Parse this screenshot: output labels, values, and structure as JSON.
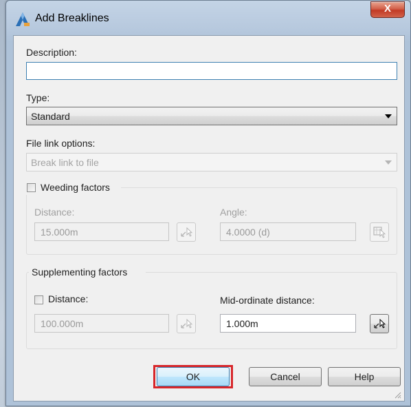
{
  "window": {
    "title": "Add Breaklines",
    "close_label": "X"
  },
  "description": {
    "label": "Description:",
    "value": ""
  },
  "type": {
    "label": "Type:",
    "selected": "Standard"
  },
  "file_link": {
    "label": "File link options:",
    "selected": "Break link to file"
  },
  "weeding": {
    "label": "Weeding factors",
    "checked": false,
    "distance_label": "Distance:",
    "distance_value": "15.000m",
    "angle_label": "Angle:",
    "angle_value": "4.0000 (d)"
  },
  "supplementing": {
    "label": "Supplementing factors",
    "distance_label": "Distance:",
    "distance_checked": false,
    "distance_value": "100.000m",
    "midordinate_label": "Mid-ordinate distance:",
    "midordinate_value": "1.000m"
  },
  "buttons": {
    "ok": "OK",
    "cancel": "Cancel",
    "help": "Help"
  },
  "colors": {
    "highlight": "#d7262a",
    "close_button": "#c23a25",
    "default_button_border": "#3c7fb1"
  },
  "icons": {
    "app": "autocad-civil3d-icon",
    "pick": "pick-from-drawing-icon"
  }
}
